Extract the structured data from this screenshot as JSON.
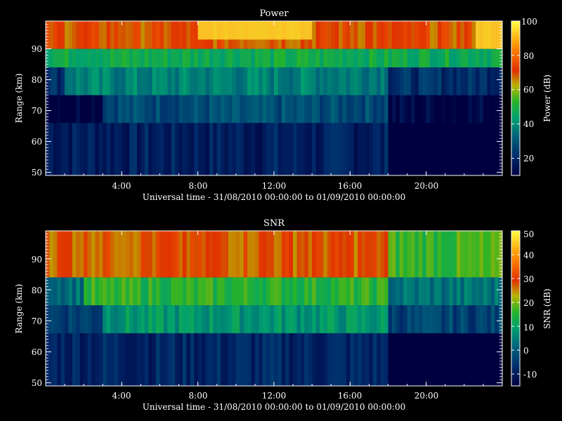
{
  "chart_data": [
    {
      "type": "heatmap",
      "title": "Power",
      "xlabel": "Universal time - 31/08/2010 00:00:00 to 01/09/2010 00:00:00",
      "ylabel": "Range (km)",
      "xlim": [
        0,
        24
      ],
      "ylim": [
        49,
        99
      ],
      "x_ticks": [
        4,
        8,
        12,
        16,
        20
      ],
      "x_tick_labels": [
        "4:00",
        "8:00",
        "12:00",
        "16:00",
        "20:00"
      ],
      "y_ticks": [
        50,
        60,
        70,
        80,
        90
      ],
      "y_tick_labels": [
        "50",
        "60",
        "70",
        "80",
        "90"
      ],
      "colorbar": {
        "label": "Power (dB)",
        "range": [
          10,
          100
        ],
        "ticks": [
          20,
          40,
          60,
          80,
          100
        ],
        "tick_labels": [
          "20",
          "40",
          "60",
          "80",
          "100"
        ]
      },
      "colormap": [
        "#000040",
        "#002a6a",
        "#00607a",
        "#00a070",
        "#28b428",
        "#b8b400",
        "#e03000",
        "#ff9000",
        "#ffff40"
      ],
      "layers": [
        {
          "range_km": [
            49,
            66
          ],
          "value_db": 18,
          "hours": [
            0,
            18
          ]
        },
        {
          "range_km": [
            66,
            75
          ],
          "value_db": 28,
          "hours": [
            3,
            18
          ]
        },
        {
          "range_km": [
            75,
            84
          ],
          "value_db": 38,
          "hours": [
            1,
            18
          ]
        },
        {
          "range_km": [
            84,
            90
          ],
          "value_db": 48,
          "hours": [
            0,
            24
          ]
        },
        {
          "range_km": [
            90,
            99
          ],
          "value_db": 70,
          "hours": [
            0,
            24
          ]
        }
      ],
      "peaks": [
        {
          "hours": [
            8,
            14
          ],
          "range_km": [
            93,
            99
          ],
          "value_db": 95
        },
        {
          "hours": [
            22.6,
            24
          ],
          "range_km": [
            90,
            99
          ],
          "value_db": 95
        }
      ]
    },
    {
      "type": "heatmap",
      "title": "SNR",
      "xlabel": "Universal time - 31/08/2010 00:00:00 to 01/09/2010 00:00:00",
      "ylabel": "Range (km)",
      "xlim": [
        0,
        24
      ],
      "ylim": [
        49,
        99
      ],
      "x_ticks": [
        4,
        8,
        12,
        16,
        20
      ],
      "x_tick_labels": [
        "4:00",
        "8:00",
        "12:00",
        "16:00",
        "20:00"
      ],
      "y_ticks": [
        50,
        60,
        70,
        80,
        90
      ],
      "y_tick_labels": [
        "50",
        "60",
        "70",
        "80",
        "90"
      ],
      "colorbar": {
        "label": "SNR (dB)",
        "range": [
          -15,
          50
        ],
        "ticks": [
          -10,
          0,
          10,
          20,
          30,
          40,
          50
        ],
        "tick_labels": [
          "-10",
          "0",
          "10",
          "20",
          "30",
          "40",
          "50"
        ]
      },
      "colormap": [
        "#000040",
        "#002a6a",
        "#00607a",
        "#00a070",
        "#28b428",
        "#b8b400",
        "#e03000",
        "#ff9000",
        "#ffff40"
      ],
      "layers": [
        {
          "range_km": [
            49,
            66
          ],
          "value_db": -8,
          "hours": [
            0,
            18
          ]
        },
        {
          "range_km": [
            66,
            75
          ],
          "value_db": 8,
          "hours": [
            3,
            18
          ]
        },
        {
          "range_km": [
            75,
            84
          ],
          "value_db": 15,
          "hours": [
            2,
            18
          ]
        },
        {
          "range_km": [
            84,
            99
          ],
          "value_db": 28,
          "hours": [
            0,
            18
          ]
        }
      ]
    }
  ]
}
